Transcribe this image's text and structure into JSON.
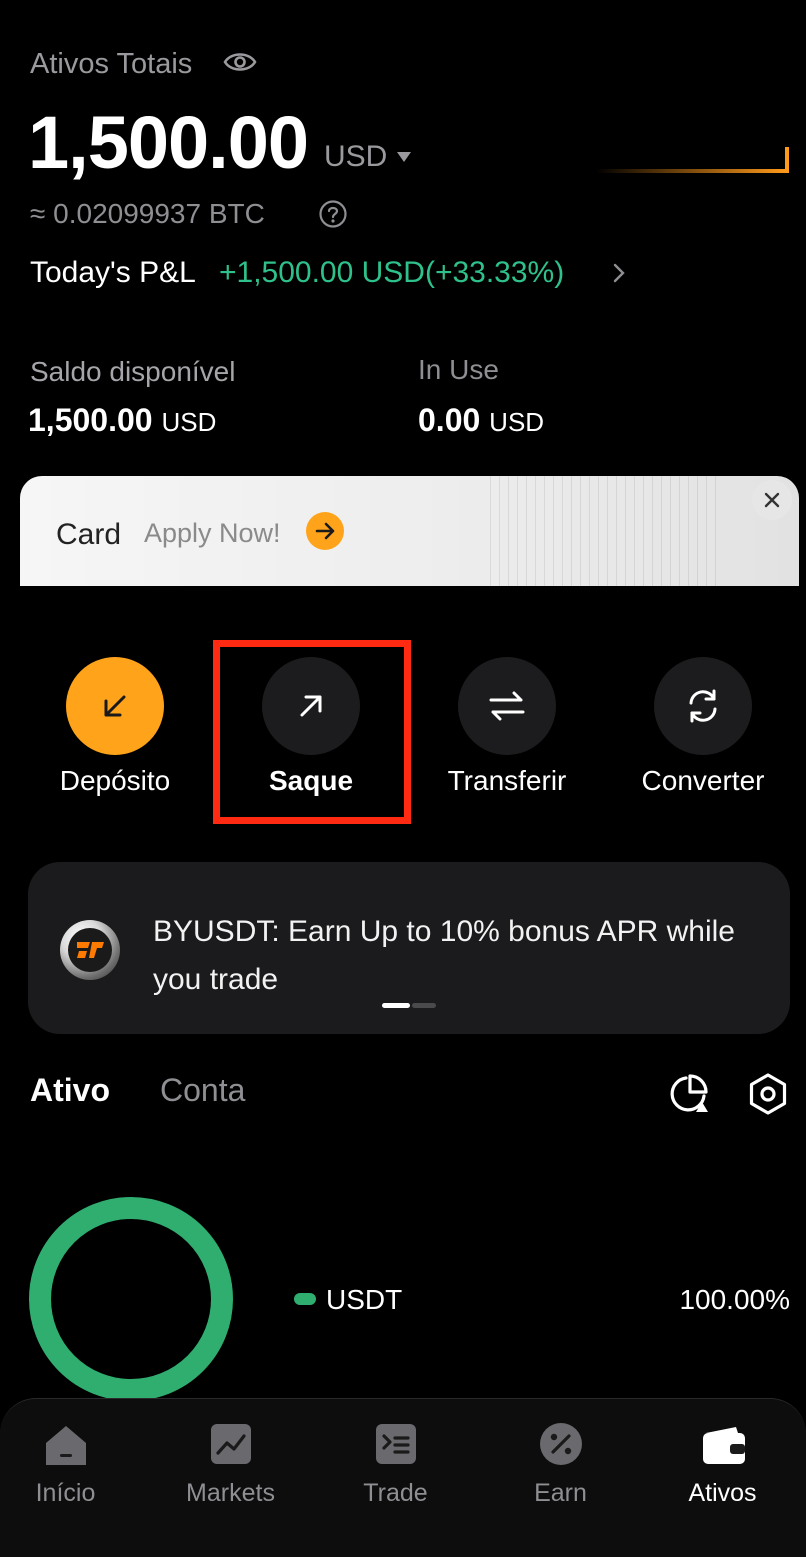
{
  "header": {
    "total_label": "Ativos Totais",
    "balance": "1,500.00",
    "currency": "USD",
    "btc_equiv": "≈ 0.02099937 BTC",
    "pnl_label": "Today's P&L",
    "pnl_value": "+1,500.00 USD(+33.33%)"
  },
  "balances": {
    "available_label": "Saldo disponível",
    "available_value": "1,500.00",
    "available_unit": "USD",
    "inuse_label": "In Use",
    "inuse_value": "0.00",
    "inuse_unit": "USD"
  },
  "banner": {
    "title": "Card",
    "cta": "Apply Now!",
    "close": "×"
  },
  "actions": [
    {
      "label": "Depósito",
      "icon": "arrow-down-left-icon"
    },
    {
      "label": "Saque",
      "icon": "arrow-up-right-icon"
    },
    {
      "label": "Transferir",
      "icon": "transfer-icon"
    },
    {
      "label": "Converter",
      "icon": "convert-icon"
    }
  ],
  "promo": {
    "text": "BYUSDT: Earn Up to 10% bonus APR while you trade"
  },
  "tabs": [
    {
      "label": "Ativo",
      "active": true
    },
    {
      "label": "Conta",
      "active": false
    }
  ],
  "allocation": {
    "items": [
      {
        "name": "USDT",
        "percent": "100.00%",
        "share": 1.0,
        "color": "#2fae6f"
      }
    ]
  },
  "nav": [
    {
      "label": "Início",
      "icon": "home-icon"
    },
    {
      "label": "Markets",
      "icon": "markets-icon"
    },
    {
      "label": "Trade",
      "icon": "trade-icon"
    },
    {
      "label": "Earn",
      "icon": "earn-icon"
    },
    {
      "label": "Ativos",
      "icon": "wallet-icon",
      "active": true
    }
  ],
  "colors": {
    "accent": "#ffa31a",
    "positive": "#2fc18b",
    "highlight": "#ff2a12"
  }
}
